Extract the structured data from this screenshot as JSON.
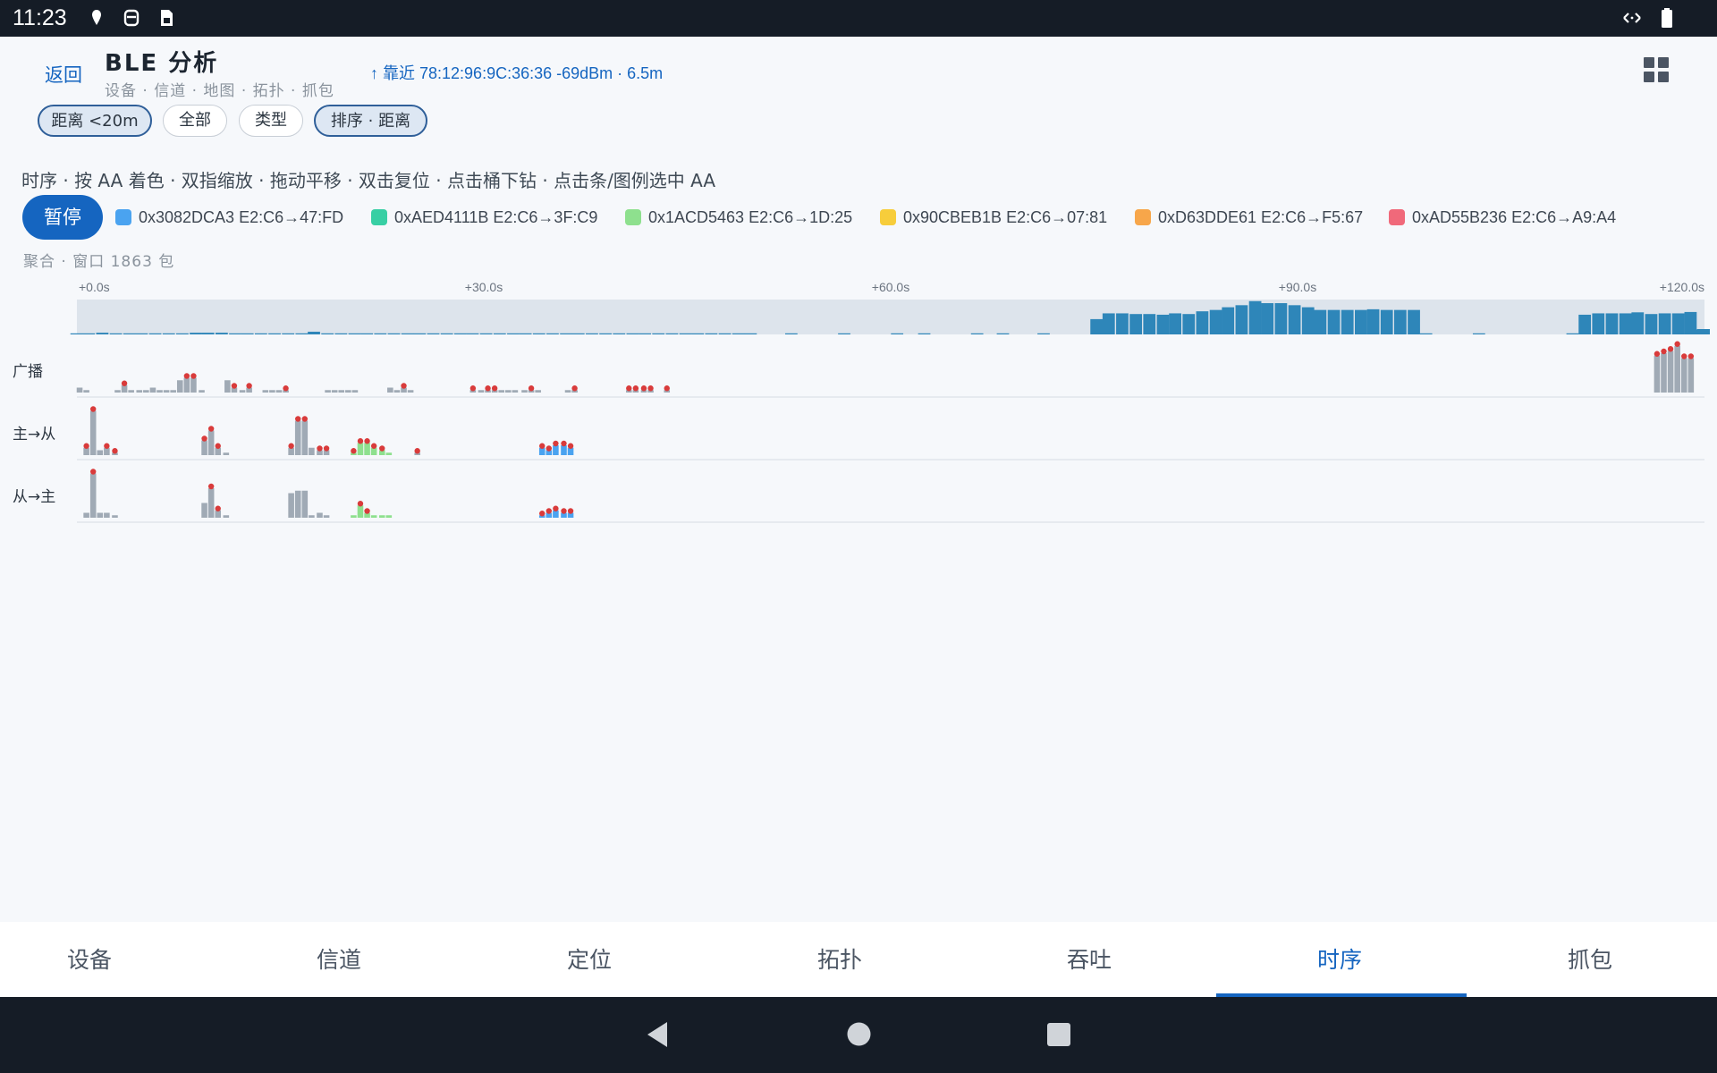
{
  "status_bar": {
    "time": "11:23"
  },
  "header": {
    "back_label": "返回",
    "title": "BLE 分析",
    "subtitle": "设备 · 信道 · 地图 · 拓扑 · 抓包",
    "nearest": "↑ 靠近 78:12:96:9C:36:36 -69dBm · 6.5m"
  },
  "filters": [
    {
      "label": "距离 <20m",
      "active": true
    },
    {
      "label": "全部",
      "active": false
    },
    {
      "label": "类型",
      "active": false
    },
    {
      "label": "排序 · 距离",
      "active": true
    }
  ],
  "hint": "时序 · 按 AA 着色 · 双指缩放 · 拖动平移 · 双击复位 · 点击桶下钻 · 点击条/图例选中 AA",
  "pause_label": "暂停",
  "legend": [
    {
      "label": "0x3082DCA3 E2:C6→47:FD",
      "color": "#4aa3f0"
    },
    {
      "label": "0xAED4111B E2:C6→3F:C9",
      "color": "#38cfa4"
    },
    {
      "label": "0x1ACD5463 E2:C6→1D:25",
      "color": "#8ee08e"
    },
    {
      "label": "0x90CBEB1B E2:C6→07:81",
      "color": "#f7cd3b"
    },
    {
      "label": "0xD63DDE61 E2:C6→F5:67",
      "color": "#f7a64a"
    },
    {
      "label": "0xAD55B236 E2:C6→A9:A4",
      "color": "#f0697a"
    }
  ],
  "aggregate_label": "聚合 · 窗口 1863 包",
  "chart_data": {
    "type": "bar",
    "x_unit": "s",
    "xlim": [
      0,
      120
    ],
    "x_ticks": [
      "+0.0s",
      "+30.0s",
      "+60.0s",
      "+90.0s",
      "+120.0s"
    ],
    "overview_color": "#2e86b9",
    "overview": [
      [
        0.0,
        1
      ],
      [
        0.9,
        3
      ],
      [
        1.9,
        5
      ],
      [
        2.9,
        1
      ],
      [
        3.9,
        1
      ],
      [
        4.8,
        1
      ],
      [
        5.8,
        1
      ],
      [
        6.8,
        1
      ],
      [
        7.8,
        3
      ],
      [
        8.8,
        5
      ],
      [
        9.7,
        5
      ],
      [
        10.7,
        5
      ],
      [
        11.7,
        2
      ],
      [
        12.6,
        2
      ],
      [
        13.6,
        1
      ],
      [
        14.6,
        1
      ],
      [
        15.6,
        1
      ],
      [
        16.6,
        2
      ],
      [
        17.5,
        8
      ],
      [
        18.5,
        1
      ],
      [
        19.5,
        1
      ],
      [
        20.5,
        1
      ],
      [
        21.4,
        3
      ],
      [
        22.4,
        2
      ],
      [
        23.4,
        2
      ],
      [
        24.4,
        1
      ],
      [
        25.3,
        1
      ],
      [
        26.3,
        2
      ],
      [
        27.3,
        2
      ],
      [
        28.3,
        1
      ],
      [
        29.2,
        1
      ],
      [
        30.2,
        2
      ],
      [
        31.2,
        1
      ],
      [
        32.2,
        1
      ],
      [
        33.1,
        1
      ],
      [
        34.1,
        1
      ],
      [
        35.1,
        2
      ],
      [
        36.1,
        1
      ],
      [
        37.0,
        2
      ],
      [
        38.0,
        1
      ],
      [
        39.0,
        1
      ],
      [
        40.0,
        1
      ],
      [
        41.0,
        1
      ],
      [
        41.9,
        1
      ],
      [
        42.9,
        1
      ],
      [
        43.9,
        1
      ],
      [
        44.9,
        1
      ],
      [
        45.8,
        1
      ],
      [
        46.8,
        1
      ],
      [
        47.8,
        1
      ],
      [
        48.8,
        1
      ],
      [
        49.7,
        1
      ],
      [
        52.7,
        1
      ],
      [
        56.6,
        1
      ],
      [
        60.5,
        1
      ],
      [
        62.5,
        1
      ],
      [
        66.4,
        1
      ],
      [
        68.3,
        1
      ],
      [
        71.3,
        1
      ],
      [
        75.2,
        45
      ],
      [
        76.1,
        62
      ],
      [
        77.1,
        62
      ],
      [
        78.1,
        60
      ],
      [
        79.1,
        60
      ],
      [
        80.1,
        58
      ],
      [
        81.0,
        62
      ],
      [
        82.0,
        60
      ],
      [
        83.0,
        68
      ],
      [
        84.0,
        72
      ],
      [
        84.9,
        80
      ],
      [
        85.9,
        86
      ],
      [
        86.9,
        98
      ],
      [
        87.8,
        92
      ],
      [
        88.8,
        92
      ],
      [
        89.8,
        86
      ],
      [
        90.8,
        80
      ],
      [
        91.7,
        72
      ],
      [
        92.7,
        72
      ],
      [
        93.7,
        72
      ],
      [
        94.7,
        72
      ],
      [
        95.6,
        74
      ],
      [
        96.6,
        72
      ],
      [
        97.6,
        72
      ],
      [
        98.6,
        72
      ],
      [
        99.5,
        1
      ],
      [
        103.4,
        1
      ],
      [
        110.3,
        1
      ],
      [
        111.2,
        58
      ],
      [
        112.2,
        62
      ],
      [
        113.2,
        62
      ],
      [
        114.2,
        62
      ],
      [
        115.1,
        65
      ],
      [
        116.1,
        60
      ],
      [
        117.1,
        62
      ],
      [
        118.1,
        62
      ],
      [
        119.0,
        66
      ],
      [
        119.6,
        15
      ]
    ],
    "rows": [
      {
        "label": "广播",
        "bars": [
          [
            0.2,
            2,
            "#a0aab5"
          ],
          [
            0.7,
            1,
            "#a0aab5"
          ],
          [
            3.0,
            1,
            "#a0aab5"
          ],
          [
            3.5,
            3,
            "#a0aab5"
          ],
          [
            4.0,
            1,
            "#a0aab5"
          ],
          [
            4.6,
            1,
            "#a0aab5"
          ],
          [
            5.1,
            1,
            "#a0aab5"
          ],
          [
            5.6,
            2,
            "#a0aab5"
          ],
          [
            6.1,
            1,
            "#a0aab5"
          ],
          [
            6.6,
            1,
            "#a0aab5"
          ],
          [
            7.1,
            1,
            "#a0aab5"
          ],
          [
            7.6,
            5,
            "#a0aab5"
          ],
          [
            8.1,
            6,
            "#a0aab5"
          ],
          [
            8.6,
            6,
            "#a0aab5"
          ],
          [
            9.2,
            1,
            "#a0aab5"
          ],
          [
            11.1,
            5,
            "#a0aab5"
          ],
          [
            11.6,
            2,
            "#a0aab5"
          ],
          [
            12.2,
            1,
            "#a0aab5"
          ],
          [
            12.7,
            2,
            "#a0aab5"
          ],
          [
            13.9,
            1,
            "#a0aab5"
          ],
          [
            14.4,
            1,
            "#a0aab5"
          ],
          [
            14.9,
            1,
            "#a0aab5"
          ],
          [
            15.4,
            1,
            "#a0aab5"
          ],
          [
            18.5,
            1,
            "#a0aab5"
          ],
          [
            19.0,
            1,
            "#a0aab5"
          ],
          [
            19.5,
            1,
            "#a0aab5"
          ],
          [
            20.0,
            1,
            "#a0aab5"
          ],
          [
            20.5,
            1,
            "#a0aab5"
          ],
          [
            23.1,
            2,
            "#a0aab5"
          ],
          [
            23.6,
            1,
            "#a0aab5"
          ],
          [
            24.1,
            2,
            "#a0aab5"
          ],
          [
            24.6,
            1,
            "#a0aab5"
          ],
          [
            29.2,
            1,
            "#a0aab5"
          ],
          [
            29.8,
            1,
            "#a0aab5"
          ],
          [
            30.3,
            1,
            "#a0aab5"
          ],
          [
            30.8,
            1,
            "#a0aab5"
          ],
          [
            31.3,
            1,
            "#a0aab5"
          ],
          [
            31.8,
            1,
            "#a0aab5"
          ],
          [
            32.3,
            1,
            "#a0aab5"
          ],
          [
            33.0,
            1,
            "#a0aab5"
          ],
          [
            33.5,
            1,
            "#a0aab5"
          ],
          [
            34.0,
            1,
            "#a0aab5"
          ],
          [
            36.2,
            1,
            "#a0aab5"
          ],
          [
            36.7,
            1,
            "#a0aab5"
          ],
          [
            40.7,
            1,
            "#a0aab5"
          ],
          [
            41.2,
            1,
            "#a0aab5"
          ],
          [
            41.8,
            1,
            "#a0aab5"
          ],
          [
            42.3,
            1,
            "#a0aab5"
          ],
          [
            43.5,
            1,
            "#a0aab5"
          ],
          [
            116.5,
            15,
            "#a0aab5"
          ],
          [
            117.0,
            16,
            "#a0aab5"
          ],
          [
            117.5,
            17,
            "#a0aab5"
          ],
          [
            118.0,
            19,
            "#a0aab5"
          ],
          [
            118.5,
            14,
            "#a0aab5"
          ],
          [
            119.0,
            14,
            "#a0aab5"
          ]
        ],
        "markers": [
          [
            3.5,
            3
          ],
          [
            8.1,
            6
          ],
          [
            8.6,
            6
          ],
          [
            11.6,
            2
          ],
          [
            12.7,
            2
          ],
          [
            15.4,
            1
          ],
          [
            24.1,
            2
          ],
          [
            29.2,
            1
          ],
          [
            30.3,
            1
          ],
          [
            30.8,
            1
          ],
          [
            33.5,
            1
          ],
          [
            36.7,
            1
          ],
          [
            40.7,
            1
          ],
          [
            41.2,
            1
          ],
          [
            41.8,
            1
          ],
          [
            42.3,
            1
          ],
          [
            43.5,
            1
          ],
          [
            116.5,
            15
          ],
          [
            117.0,
            16
          ],
          [
            117.5,
            17
          ],
          [
            118.0,
            19
          ],
          [
            118.5,
            14
          ],
          [
            119.0,
            14
          ]
        ]
      },
      {
        "label": "主→从",
        "bars": [
          [
            0.7,
            3,
            "#a0aab5"
          ],
          [
            1.2,
            18,
            "#a0aab5"
          ],
          [
            1.7,
            2,
            "#a0aab5"
          ],
          [
            2.2,
            3,
            "#a0aab5"
          ],
          [
            2.8,
            1,
            "#a0aab5"
          ],
          [
            9.4,
            6,
            "#a0aab5"
          ],
          [
            9.9,
            10,
            "#a0aab5"
          ],
          [
            10.4,
            3,
            "#a0aab5"
          ],
          [
            11.0,
            1,
            "#a0aab5"
          ],
          [
            15.8,
            3,
            "#a0aab5"
          ],
          [
            16.3,
            14,
            "#a0aab5"
          ],
          [
            16.8,
            14,
            "#a0aab5"
          ],
          [
            17.3,
            3,
            "#a0aab5"
          ],
          [
            17.9,
            2,
            "#a0aab5"
          ],
          [
            18.4,
            2,
            "#a0aab5"
          ],
          [
            20.4,
            1,
            "#8ee08e"
          ],
          [
            20.9,
            5,
            "#8ee08e"
          ],
          [
            21.4,
            5,
            "#8ee08e"
          ],
          [
            21.9,
            3,
            "#8ee08e"
          ],
          [
            22.5,
            2,
            "#8ee08e"
          ],
          [
            23.0,
            1,
            "#8ee08e"
          ],
          [
            25.1,
            1,
            "#a0aab5"
          ],
          [
            34.3,
            3,
            "#4aa3f0"
          ],
          [
            34.8,
            2,
            "#4aa3f0"
          ],
          [
            35.3,
            4,
            "#4aa3f0"
          ],
          [
            35.9,
            4,
            "#4aa3f0"
          ],
          [
            36.4,
            3,
            "#4aa3f0"
          ]
        ],
        "markers": [
          [
            0.7,
            3
          ],
          [
            1.2,
            18
          ],
          [
            2.2,
            3
          ],
          [
            2.8,
            1
          ],
          [
            9.4,
            6
          ],
          [
            9.9,
            10
          ],
          [
            10.4,
            3
          ],
          [
            15.8,
            3
          ],
          [
            16.3,
            14
          ],
          [
            16.8,
            14
          ],
          [
            17.9,
            2
          ],
          [
            18.4,
            2
          ],
          [
            20.4,
            1
          ],
          [
            20.9,
            5
          ],
          [
            21.4,
            5
          ],
          [
            21.9,
            3
          ],
          [
            22.5,
            2
          ],
          [
            25.1,
            1
          ],
          [
            34.3,
            3
          ],
          [
            34.8,
            2
          ],
          [
            35.3,
            4
          ],
          [
            35.9,
            4
          ],
          [
            36.4,
            3
          ]
        ]
      },
      {
        "label": "从→主",
        "bars": [
          [
            0.7,
            2,
            "#a0aab5"
          ],
          [
            1.2,
            18,
            "#a0aab5"
          ],
          [
            1.7,
            2,
            "#a0aab5"
          ],
          [
            2.2,
            2,
            "#a0aab5"
          ],
          [
            2.8,
            1,
            "#a0aab5"
          ],
          [
            9.4,
            6,
            "#a0aab5"
          ],
          [
            9.9,
            12,
            "#a0aab5"
          ],
          [
            10.4,
            3,
            "#a0aab5"
          ],
          [
            11.0,
            1,
            "#a0aab5"
          ],
          [
            15.8,
            10,
            "#a0aab5"
          ],
          [
            16.3,
            11,
            "#a0aab5"
          ],
          [
            16.8,
            11,
            "#a0aab5"
          ],
          [
            17.3,
            1,
            "#a0aab5"
          ],
          [
            17.9,
            2,
            "#a0aab5"
          ],
          [
            18.4,
            1,
            "#a0aab5"
          ],
          [
            20.4,
            1,
            "#8ee08e"
          ],
          [
            20.9,
            5,
            "#8ee08e"
          ],
          [
            21.4,
            2,
            "#8ee08e"
          ],
          [
            21.9,
            1,
            "#8ee08e"
          ],
          [
            22.5,
            1,
            "#8ee08e"
          ],
          [
            23.0,
            1,
            "#8ee08e"
          ],
          [
            34.3,
            1,
            "#4aa3f0"
          ],
          [
            34.8,
            2,
            "#4aa3f0"
          ],
          [
            35.3,
            3,
            "#4aa3f0"
          ],
          [
            35.9,
            2,
            "#4aa3f0"
          ],
          [
            36.4,
            2,
            "#4aa3f0"
          ]
        ],
        "markers": [
          [
            1.2,
            18
          ],
          [
            9.9,
            12
          ],
          [
            10.4,
            3
          ],
          [
            20.9,
            5
          ],
          [
            21.4,
            2
          ],
          [
            34.3,
            1
          ],
          [
            34.8,
            2
          ],
          [
            35.3,
            3
          ],
          [
            35.9,
            2
          ],
          [
            36.4,
            2
          ]
        ]
      }
    ]
  },
  "bottom_nav": [
    {
      "label": "设备",
      "active": false
    },
    {
      "label": "信道",
      "active": false
    },
    {
      "label": "定位",
      "active": false
    },
    {
      "label": "拓扑",
      "active": false
    },
    {
      "label": "吞吐",
      "active": false
    },
    {
      "label": "时序",
      "active": true
    },
    {
      "label": "抓包",
      "active": false
    }
  ],
  "icons": [
    "location-icon",
    "vpn-key-icon",
    "sim-card-icon",
    "data-transfer-icon",
    "battery-icon",
    "grid-view-icon",
    "back-icon",
    "home-icon",
    "recents-icon"
  ]
}
